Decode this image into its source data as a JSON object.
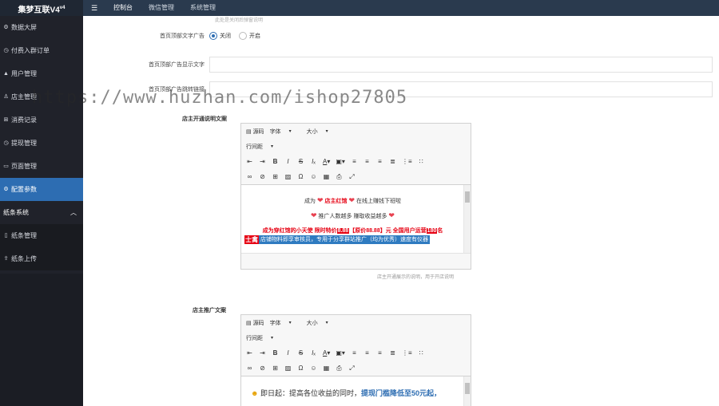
{
  "brand": {
    "name": "集梦互联V4",
    "version": "v4"
  },
  "sidebar": {
    "items": [
      {
        "label": "数据大屏",
        "icon": "gear-icon"
      },
      {
        "label": "付费入群订单",
        "icon": "clock-icon"
      },
      {
        "label": "用户管理",
        "icon": "user-icon"
      },
      {
        "label": "店主管理",
        "icon": "person-icon"
      },
      {
        "label": "消费记录",
        "icon": "cart-icon"
      },
      {
        "label": "提现管理",
        "icon": "clock-icon"
      },
      {
        "label": "页面管理",
        "icon": "doc-icon"
      },
      {
        "label": "配置参数",
        "icon": "gear-icon",
        "active": true
      }
    ],
    "group": {
      "label": "纸条系统",
      "icon": "chevron-up-icon"
    },
    "sub_items": [
      {
        "label": "纸条管理",
        "icon": "doc-icon"
      },
      {
        "label": "纸条上传",
        "icon": "upload-icon"
      }
    ]
  },
  "topbar": {
    "menu_icon": "☰",
    "tabs": [
      {
        "label": "控制台",
        "active": true
      },
      {
        "label": "微信管理"
      },
      {
        "label": "系统管理"
      }
    ]
  },
  "form": {
    "top_hint": "此处是关闭后弹窗说明",
    "ad_switch": {
      "label": "首页顶部文字广告",
      "options": [
        "关闭",
        "开启"
      ],
      "selected": "关闭"
    },
    "ad_text": {
      "label": "首页顶部广告显示文字",
      "value": ""
    },
    "ad_link": {
      "label": "首页顶部广告跳转链接",
      "value": ""
    }
  },
  "editor1": {
    "label": "店主开通说明文案",
    "toolbar": {
      "source": "源码",
      "font": "字体",
      "size": "大小",
      "line_height": "行间距"
    },
    "content": {
      "l1_pre": "成为",
      "l1_red": "店主红馆",
      "l1_post": "在线上赚钱下班啦",
      "l2": "推广人数越多 赚取收益越多",
      "l3_a": "成为穿红馆的小天使 限时特价",
      "l3_price": "8.88",
      "l3_b": "【原价88.88】元 全国用户运营",
      "l3_c": "180",
      "l3_d": "名",
      "l4_tag": "士禽",
      "l4_bar": "店铺物料即享审核员，专用于分享群站推广（均为优秀）速度有仪器"
    },
    "help": "店主开通展示的说明，用于开店说明"
  },
  "editor2": {
    "label": "店主推广文案",
    "toolbar": {
      "source": "源码",
      "font": "字体",
      "size": "大小",
      "line_height": "行间距"
    },
    "content": {
      "a": "即日起：提高各位收益的同时，",
      "b": "提现门槛降低至50元起，"
    }
  },
  "watermark": "https://www.huzhan.com/ishop27805",
  "colors": {
    "sidebar": "#20222a",
    "active": "#2d6db2",
    "topbar": "#2a3a4e",
    "accent_red": "#e60012"
  }
}
